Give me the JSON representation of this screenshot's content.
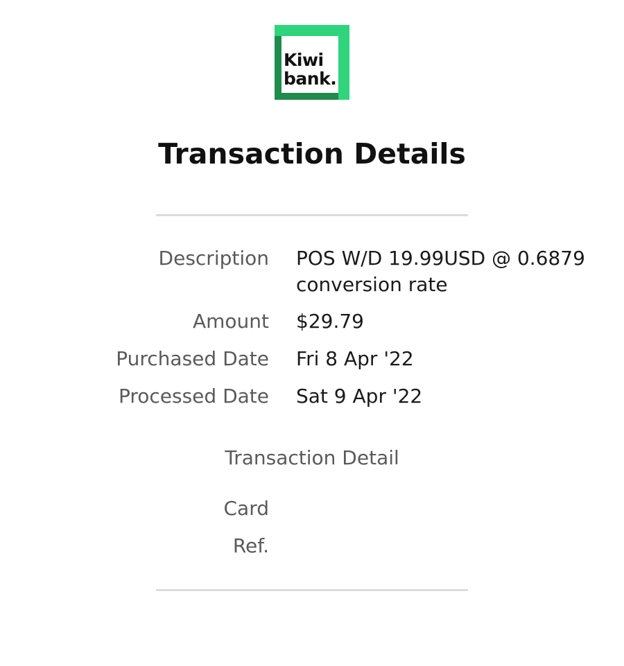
{
  "logo": {
    "line1": "Kiwi",
    "line2": "bank.",
    "colors": {
      "frame_light": "#2fd47d",
      "frame_dark": "#1f8b4c",
      "text": "#111111"
    }
  },
  "page": {
    "title": "Transaction Details"
  },
  "details": [
    {
      "label": "Description",
      "value": "POS W/D 19.99USD @ 0.6879 conversion rate"
    },
    {
      "label": "Amount",
      "value": "$29.79"
    },
    {
      "label": "Purchased Date",
      "value": "Fri 8 Apr '22"
    },
    {
      "label": "Processed Date",
      "value": "Sat 9 Apr '22"
    }
  ],
  "transaction_detail": {
    "heading": "Transaction Detail",
    "rows": [
      {
        "label": "Card",
        "value": ""
      },
      {
        "label": "Ref.",
        "value": ""
      }
    ]
  },
  "colors": {
    "label_text": "#5a5a5a",
    "value_text": "#1a1a1a",
    "divider": "#d8dcdc",
    "background": "#ffffff"
  }
}
